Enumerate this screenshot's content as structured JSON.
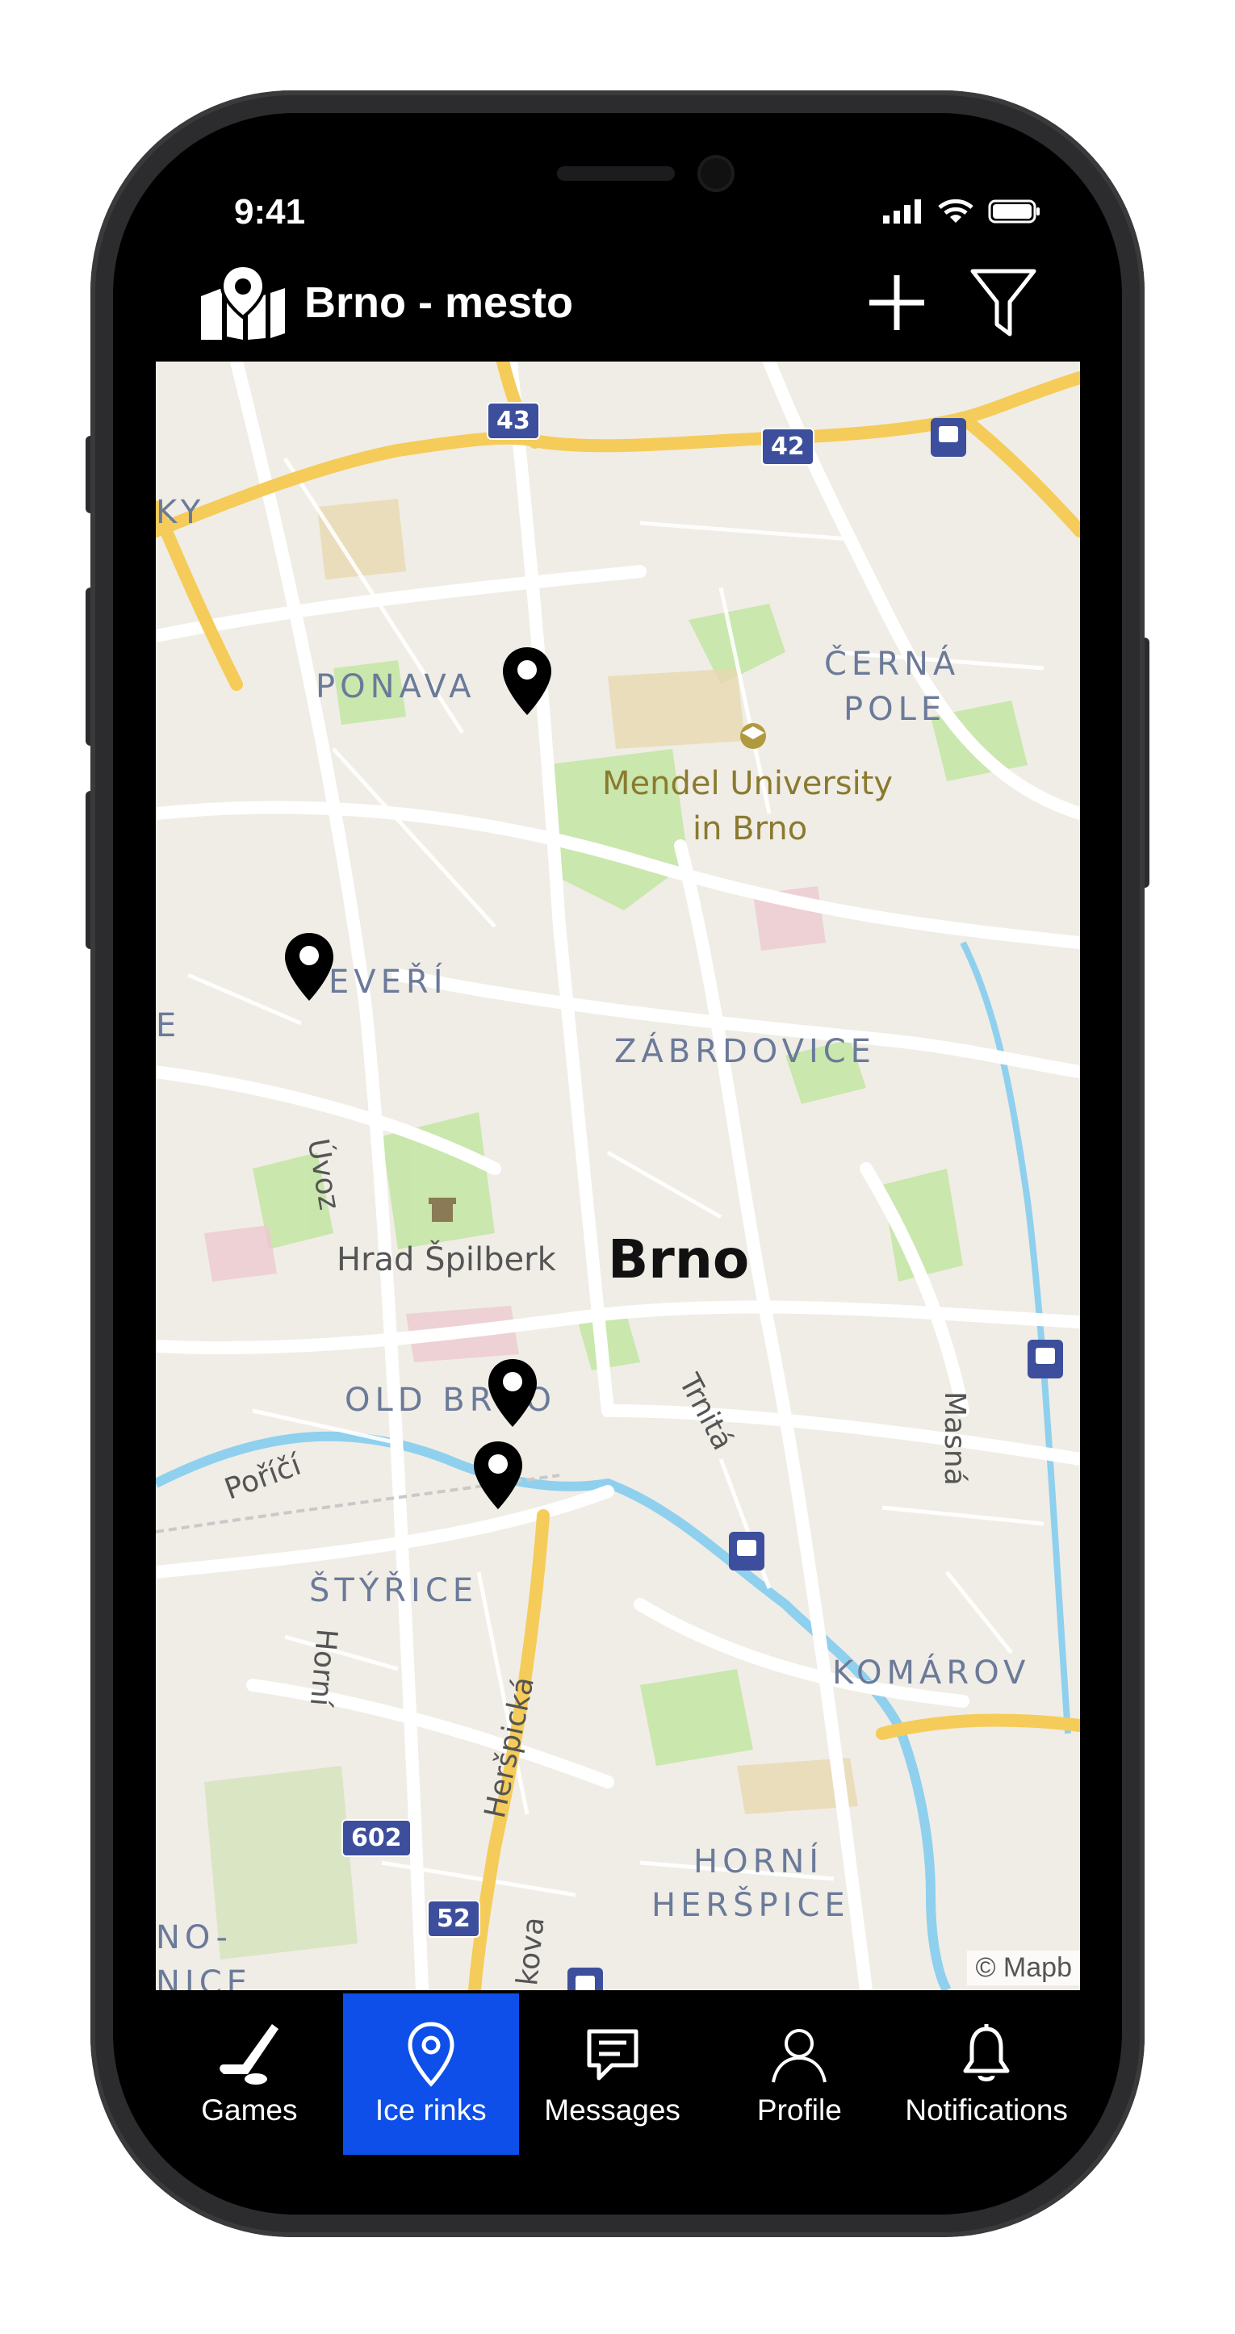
{
  "status_bar": {
    "time": "9:41"
  },
  "header": {
    "title": "Brno - mesto",
    "icons": {
      "location": "map-location-icon",
      "add": "plus-icon",
      "filter": "filter-icon"
    }
  },
  "map": {
    "labels": {
      "ponava": "PONAVA",
      "cerna": "ČERNÁ",
      "pole": "POLE",
      "mendel1": "Mendel University",
      "mendel2": "in Brno",
      "veveri": "EVEŘÍ",
      "zabrdovice": "ZÁBRDOVICE",
      "uvoz": "Úvoz",
      "spilberk": "Hrad Špilberk",
      "brno": "Brno",
      "old_brno": "OLD BRNO",
      "trnita": "Trnitá",
      "masna": "Masná",
      "porici": "Poříčí",
      "styrice": "ŠTÝŘICE",
      "horni_street": "Horní",
      "herspicka": "Heršpická",
      "komarov": "KOMÁROV",
      "horni": "HORNÍ",
      "herspice": "HERŠPICE",
      "edge_ky": "KY",
      "edge_no": "NO-",
      "edge_nice": "NICE",
      "edge_e": "E",
      "kova": "kova"
    },
    "road_shields": [
      "43",
      "42",
      "602",
      "52"
    ],
    "attribution": "© Mapb"
  },
  "tabs": [
    {
      "label": "Games",
      "icon": "hockey-stick-icon",
      "active": false
    },
    {
      "label": "Ice rinks",
      "icon": "location-pin-icon",
      "active": true
    },
    {
      "label": "Messages",
      "icon": "message-icon",
      "active": false
    },
    {
      "label": "Profile",
      "icon": "user-icon",
      "active": false
    },
    {
      "label": "Notifications",
      "icon": "bell-icon",
      "active": false
    }
  ],
  "colors": {
    "accent": "#0d4fe8",
    "background": "#000000",
    "map_bg": "#f0ede6"
  }
}
